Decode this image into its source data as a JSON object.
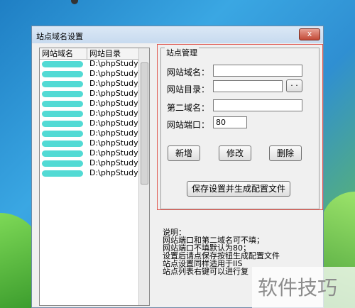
{
  "window": {
    "title": "站点域名设置",
    "close_label": "x"
  },
  "list": {
    "headers": [
      "网站域名",
      "网站目录"
    ],
    "rows": [
      {
        "dir": "D:\\phpStudy\\"
      },
      {
        "dir": "D:\\phpStudy\\"
      },
      {
        "dir": "D:\\phpStudy/"
      },
      {
        "dir": "D:\\phpStudy\\"
      },
      {
        "dir": "D:\\phpStudy\\"
      },
      {
        "dir": "D:\\phpStudy\\"
      },
      {
        "dir": "D:\\phpStudy\\"
      },
      {
        "dir": "D:\\phpStudy\\"
      },
      {
        "dir": "D:\\phpStudy\\"
      },
      {
        "dir": "D:\\phpStudy\\"
      },
      {
        "dir": "D:\\phpStudy\\"
      },
      {
        "dir": "D:\\phpStudy\\"
      }
    ]
  },
  "group": {
    "title": "站点管理"
  },
  "form": {
    "domain_label": "网站域名：",
    "dir_label": "网站目录：",
    "second_domain_label": "第二域名：",
    "port_label": "网站端口：",
    "domain_value": "",
    "dir_value": "",
    "second_domain_value": "",
    "port_value": "80",
    "browse_label": "· ·"
  },
  "buttons": {
    "add": "新增",
    "edit": "修改",
    "delete": "删除",
    "save": "保存设置并生成配置文件"
  },
  "info": {
    "lines": [
      "说明：",
      "网站端口和第二域名可不填；",
      "网站端口不填默认为80；",
      "设置后请点保存按钮生成配置文件",
      "站点设置同样适用于IIS",
      "站点列表右键可以进行复"
    ]
  },
  "watermark": {
    "text": "软件技巧"
  }
}
